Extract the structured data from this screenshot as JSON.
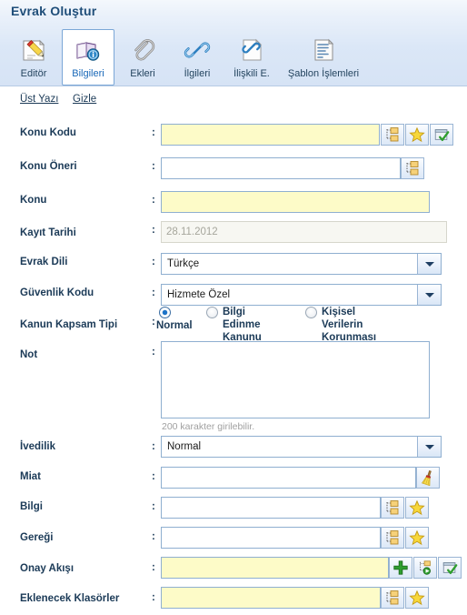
{
  "window": {
    "title": "Evrak Oluştur"
  },
  "tabs": [
    {
      "label": "Editör",
      "icon": "editor-pencil-icon",
      "active": false
    },
    {
      "label": "Bilgileri",
      "icon": "book-info-icon",
      "active": true
    },
    {
      "label": "Ekleri",
      "icon": "paperclip-icon",
      "active": false
    },
    {
      "label": "İlgileri",
      "icon": "chain-link-icon",
      "active": false
    },
    {
      "label": "İlişkili E.",
      "icon": "linked-document-icon",
      "active": false
    },
    {
      "label": "Şablon İşlemleri",
      "icon": "template-lines-icon",
      "active": false
    }
  ],
  "quick_links": [
    {
      "label": "Üst Yazı"
    },
    {
      "label": "Gizle"
    }
  ],
  "form": {
    "colon": ":",
    "fields": [
      {
        "key": "konu_kodu",
        "label": "Konu Kodu",
        "value": "",
        "required": true
      },
      {
        "key": "konu_oneri",
        "label": "Konu Öneri",
        "value": "",
        "required": false
      },
      {
        "key": "konu",
        "label": "Konu",
        "value": "",
        "required": true
      },
      {
        "key": "kayit_tarihi",
        "label": "Kayıt Tarihi",
        "value": "28.11.2012",
        "disabled": true
      },
      {
        "key": "evrak_dili",
        "label": "Evrak Dili",
        "value": "Türkçe"
      },
      {
        "key": "guvenlik_kodu",
        "label": "Güvenlik Kodu",
        "value": "Hizmete Özel"
      },
      {
        "key": "kanun_kapsam_tipi",
        "label": "Kanun Kapsam Tipi",
        "value": "Normal"
      },
      {
        "key": "not",
        "label": "Not",
        "value": ""
      },
      {
        "key": "ivedilik",
        "label": "İvedilik",
        "value": "Normal"
      },
      {
        "key": "miat",
        "label": "Miat",
        "value": ""
      },
      {
        "key": "bilgi",
        "label": "Bilgi",
        "value": ""
      },
      {
        "key": "geregi",
        "label": "Gereği",
        "value": ""
      },
      {
        "key": "onay_akisi",
        "label": "Onay Akışı",
        "value": "",
        "required": true
      },
      {
        "key": "eklenecek_klasorler",
        "label": "Eklenecek Klasörler",
        "value": "",
        "required": true
      }
    ],
    "kanun_options": [
      {
        "label": "Normal",
        "selected": true
      },
      {
        "label": "Bilgi Edinme\nKanunu",
        "selected": false
      },
      {
        "label": "Kişisel Verilerin Korunması\nKanunu",
        "selected": false
      }
    ],
    "not_hint": "200 karakter girilebilir.",
    "not_placeholder": ""
  },
  "colors": {
    "required_field_bg": "#fdfbc8",
    "field_border": "#8fafd0",
    "label_text": "#1b3a57",
    "active_tab_text": "#1968b8",
    "header_gradient_top": "#f4f8fc",
    "header_gradient_bottom": "#d6e3f5",
    "accent_green": "#2f9e2f",
    "star_yellow": "#f5d02a"
  }
}
